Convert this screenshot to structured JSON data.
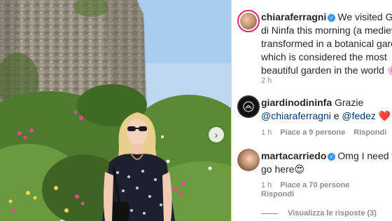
{
  "post": {
    "author": "chiaraferragni",
    "caption_lines": [
      "We visited Gia",
      "di Ninfa this morning (a medieva",
      "transformed in a botanical garde",
      "which is considered the most",
      "beautiful garden in the world"
    ],
    "caption_emoji": "🌸",
    "time": "2 h"
  },
  "comments": [
    {
      "user": "giardinodininfa",
      "text_line1": "Grazie",
      "mention1": "@chiaraferragni",
      "conj": "e",
      "mention2": "@fedez",
      "emoji": "❤️",
      "time": "1 h",
      "likes": "Piace a 9 persone",
      "reply": "Rispondi"
    },
    {
      "user": "martacarriedo",
      "text_line1": "Omg I need to",
      "text_line2": "go here",
      "emoji": "😍",
      "time": "1 h",
      "likes": "Piace a 70 persone",
      "reply": "Rispondi"
    }
  ],
  "view_replies": "Visualizza le risposte (3)",
  "icons": {
    "verified": "verified-badge-icon",
    "like": "heart-icon",
    "next": "chevron-right-icon"
  },
  "colors": {
    "verified": "#3897f0",
    "mention": "#00376b",
    "muted": "#8e8e8e",
    "story_ring": "#d62976"
  }
}
